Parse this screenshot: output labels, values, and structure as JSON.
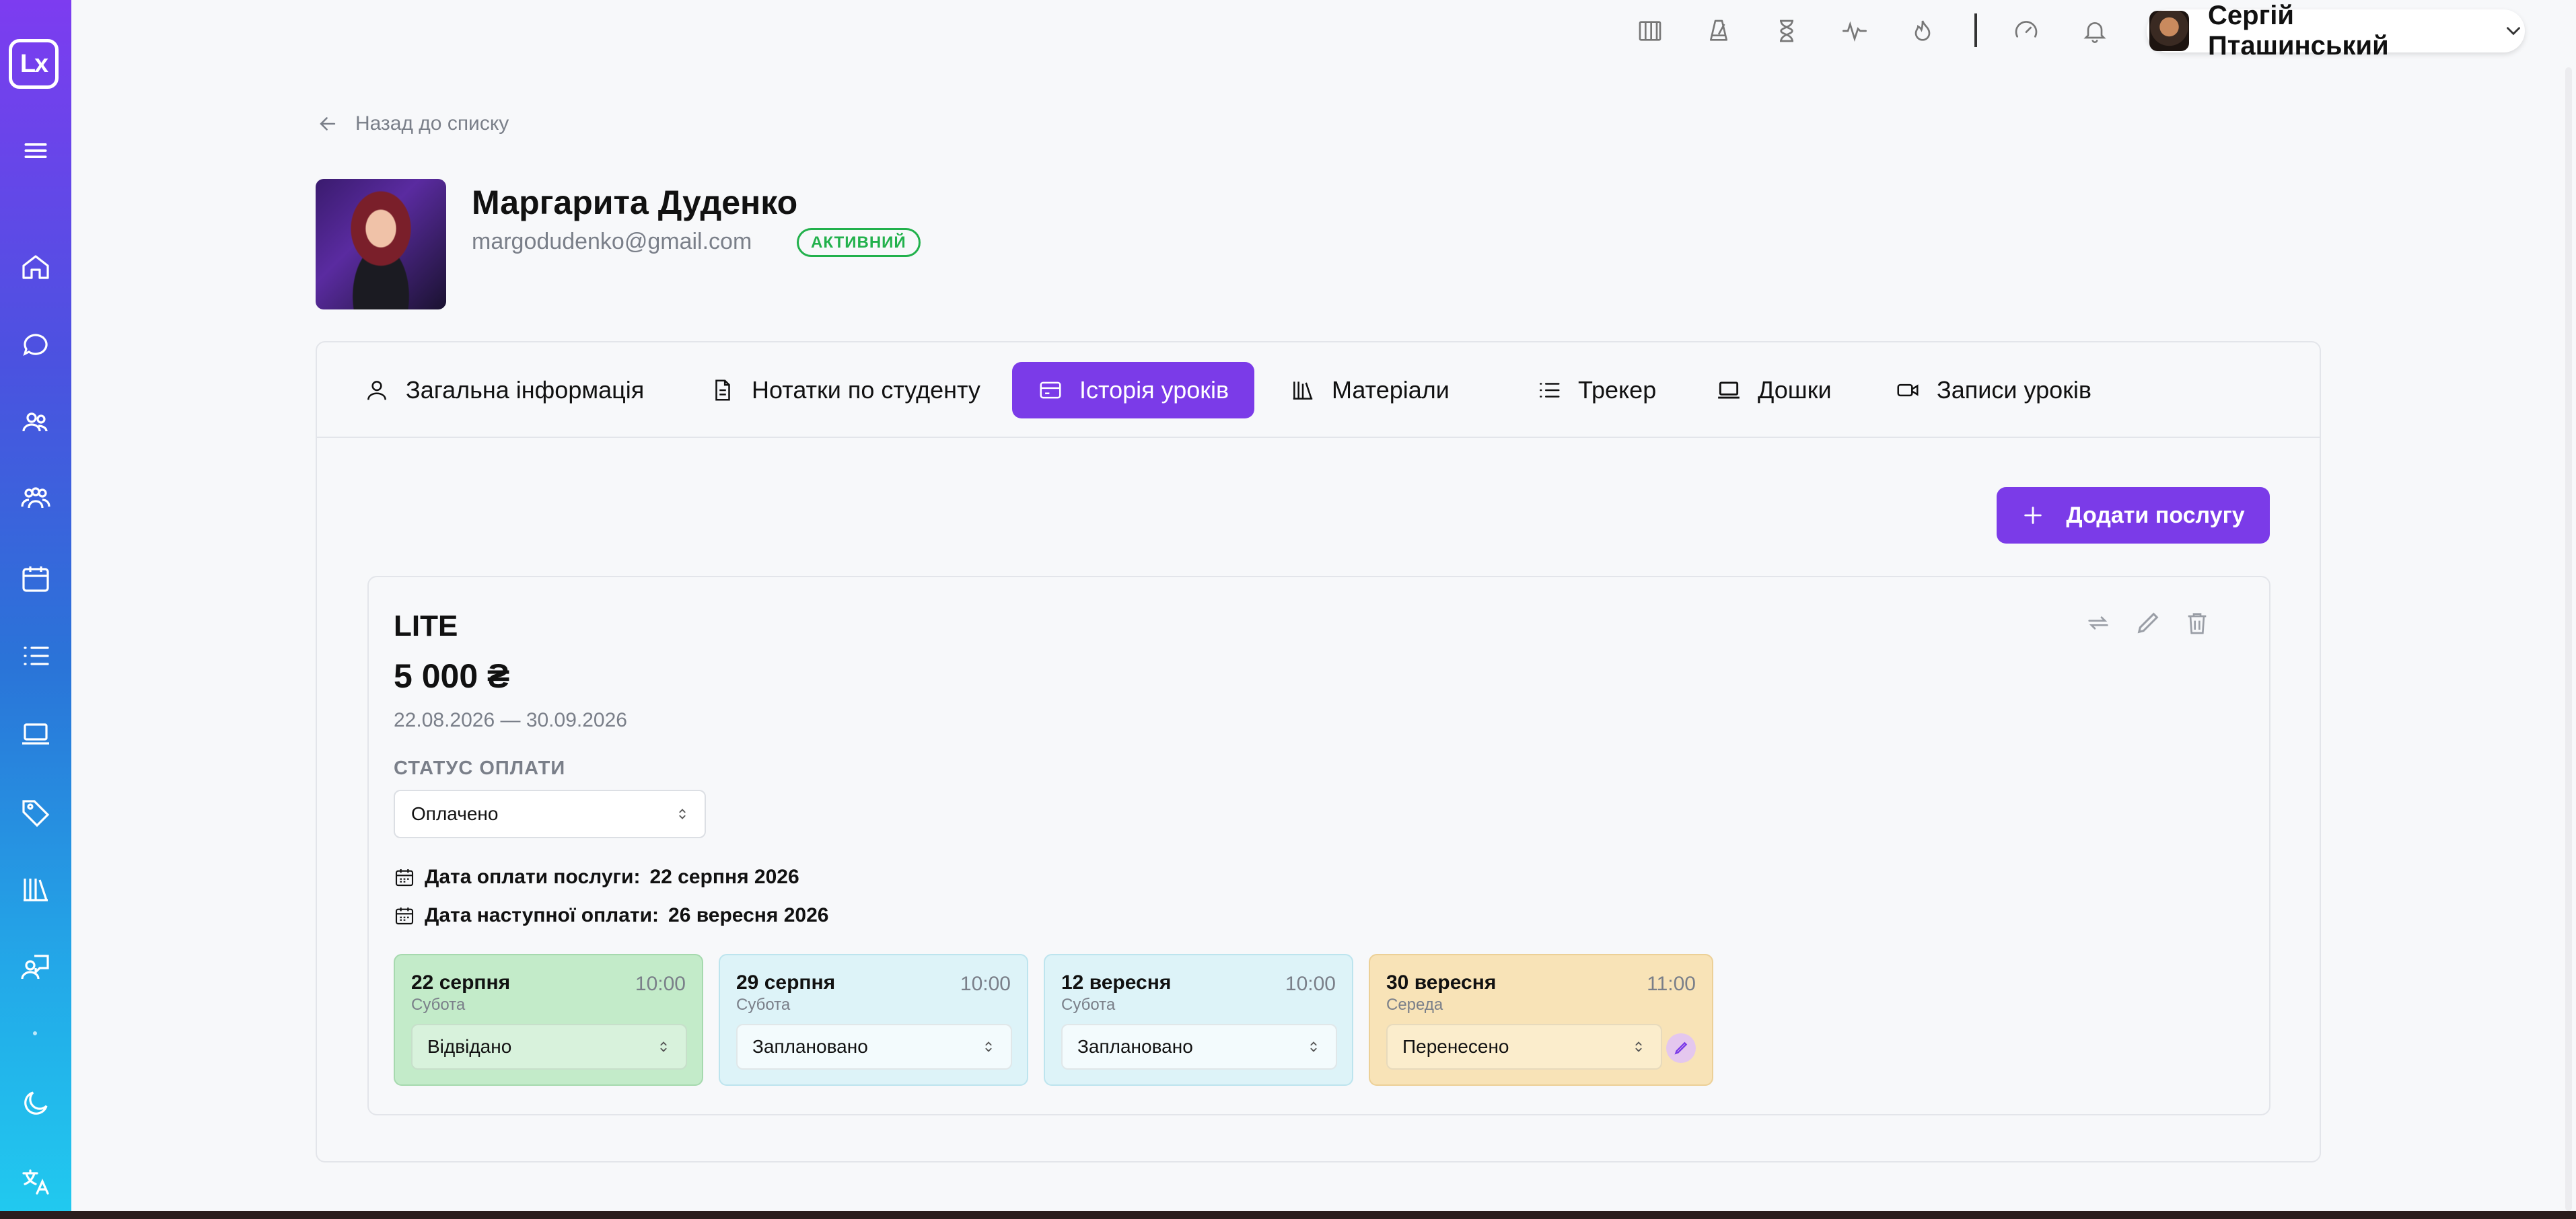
{
  "sidebar": {
    "logo_text": "Lx",
    "items": [
      {
        "name": "menu-icon"
      },
      {
        "name": "home-icon"
      },
      {
        "name": "chat-icon"
      },
      {
        "name": "students-icon"
      },
      {
        "name": "groups-icon"
      },
      {
        "name": "calendar-icon"
      },
      {
        "name": "list-icon"
      },
      {
        "name": "laptop-icon"
      },
      {
        "name": "tag-icon"
      },
      {
        "name": "library-icon"
      },
      {
        "name": "teaching-icon"
      },
      {
        "name": "moon-icon"
      },
      {
        "name": "translate-icon"
      }
    ]
  },
  "topbar": {
    "icons": [
      "piano-icon",
      "metronome-icon",
      "hourglass-icon",
      "pulse-icon",
      "flame-icon",
      "speedometer-icon",
      "bell-icon"
    ],
    "user_name": "Сергій Пташинський"
  },
  "back_link": "Назад до списку",
  "profile": {
    "name": "Маргарита Дуденко",
    "email": "margodudenko@gmail.com",
    "status": "АКТИВНИЙ"
  },
  "tabs": [
    {
      "label": "Загальна інформація",
      "icon": "user-icon"
    },
    {
      "label": "Нотатки по студенту",
      "icon": "document-icon"
    },
    {
      "label": "Історія уроків",
      "icon": "card-icon",
      "active": true
    },
    {
      "label": "Матеріали",
      "icon": "books-icon"
    },
    {
      "label": "Трекер",
      "icon": "checklist-icon"
    },
    {
      "label": "Дошки",
      "icon": "board-icon"
    },
    {
      "label": "Записи уроків",
      "icon": "video-icon"
    }
  ],
  "add_service_label": "Додати послугу",
  "service": {
    "title": "LITE",
    "price": "5 000 ₴",
    "dates": "22.08.2026 — 30.09.2026",
    "payment_status_label": "СТАТУС ОПЛАТИ",
    "payment_status_value": "Оплачено",
    "paid_date_label": "Дата оплати послуги:",
    "paid_date_value": "22 серпня 2026",
    "next_payment_label": "Дата наступної оплати:",
    "next_payment_value": "26 вересня 2026",
    "lessons": [
      {
        "date": "22 серпня",
        "day": "Субота",
        "time": "10:00",
        "status": "Відвідано",
        "kind": "visited"
      },
      {
        "date": "29 серпня",
        "day": "Субота",
        "time": "10:00",
        "status": "Заплановано",
        "kind": "planned"
      },
      {
        "date": "12 вересня",
        "day": "Субота",
        "time": "10:00",
        "status": "Заплановано",
        "kind": "planned"
      },
      {
        "date": "30 вересня",
        "day": "Середа",
        "time": "11:00",
        "status": "Перенесено",
        "kind": "moved"
      }
    ]
  },
  "colors": {
    "accent": "#7b3be8",
    "active_badge": "#22b14c",
    "visited": "#c3ebc9",
    "planned": "#ddf3f8",
    "moved": "#f8e3b7"
  }
}
